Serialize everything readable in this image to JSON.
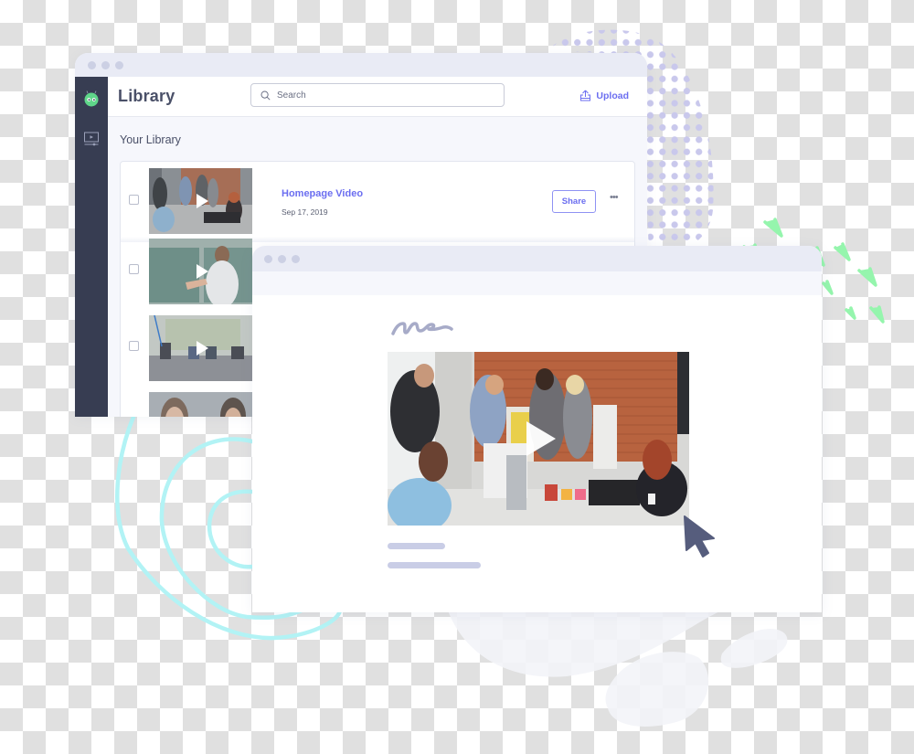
{
  "library_window": {
    "title": "Library",
    "search": {
      "placeholder": "Search",
      "value": ""
    },
    "upload_label": "Upload",
    "section_title": "Your Library",
    "sidebar": [
      {
        "icon": "robot-logo-icon",
        "label": ""
      },
      {
        "icon": "video-library-icon",
        "label": ""
      }
    ],
    "videos": [
      {
        "title": "Homepage Video",
        "date": "Sep 17, 2019",
        "share_label": "Share",
        "more_label": "•••",
        "thumbnail": "office-team-thumbnail",
        "checked": false
      },
      {
        "title": "",
        "date": "",
        "thumbnail": "presenter-whiteboard-thumbnail",
        "checked": false
      },
      {
        "title": "",
        "date": "",
        "thumbnail": "empty-classroom-thumbnail",
        "checked": false
      },
      {
        "title": "",
        "date": "",
        "thumbnail": "two-people-thumbnail",
        "checked": false
      }
    ]
  },
  "player_window": {
    "signature": "handwritten-signature",
    "video": "office-team-video",
    "placeholder_lines": 2
  },
  "colors": {
    "accent": "#6b6ef0",
    "sidebar": "#373d52",
    "titlebar": "#e9ebf5",
    "logo_green": "#5fd68a",
    "deco_cyan": "#b2f3f5",
    "deco_green": "#95f5ad",
    "deco_dots": "#c9c8ec",
    "cursor": "#565d7d"
  }
}
